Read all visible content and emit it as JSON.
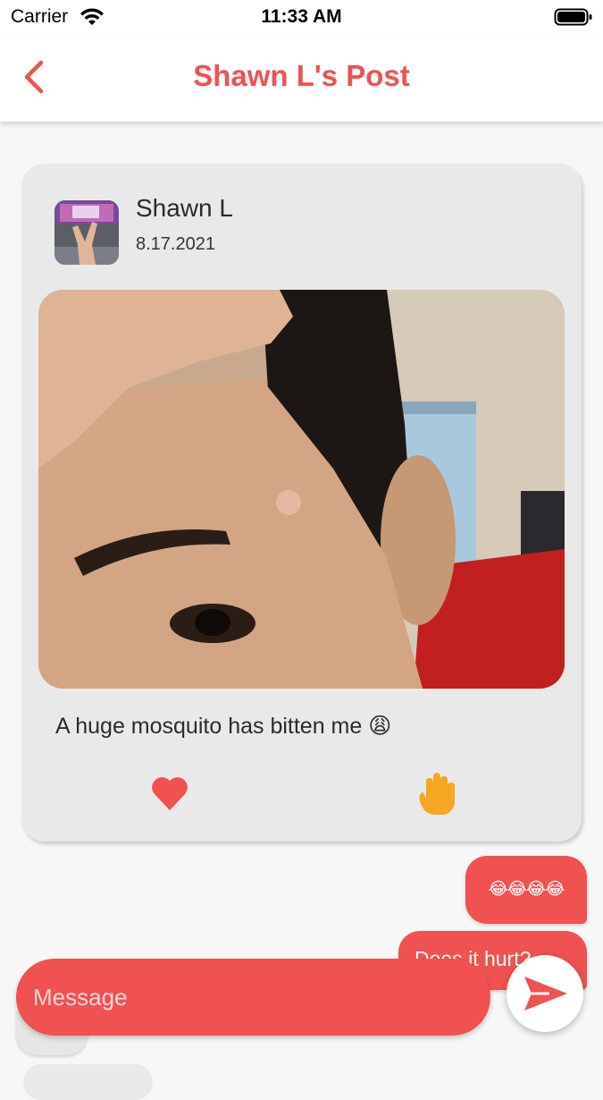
{
  "status_bar": {
    "carrier": "Carrier",
    "time": "11:33 AM"
  },
  "nav": {
    "title": "Shawn L's Post",
    "back_icon": "chevron-left-icon"
  },
  "post": {
    "author": "Shawn L",
    "date": "8.17.2021",
    "caption": "A huge mosquito has bitten me 😩",
    "like_icon": "heart-icon",
    "wave_icon": "raised-hand-icon"
  },
  "messages": [
    {
      "text": "😂😂😂😂"
    },
    {
      "text": "Does it hurt?"
    }
  ],
  "composer": {
    "placeholder": "Message",
    "send_icon": "send-arrow-icon"
  },
  "colors": {
    "accent": "#f05151",
    "card": "#e9e9e9",
    "background": "#f7f7f7"
  }
}
